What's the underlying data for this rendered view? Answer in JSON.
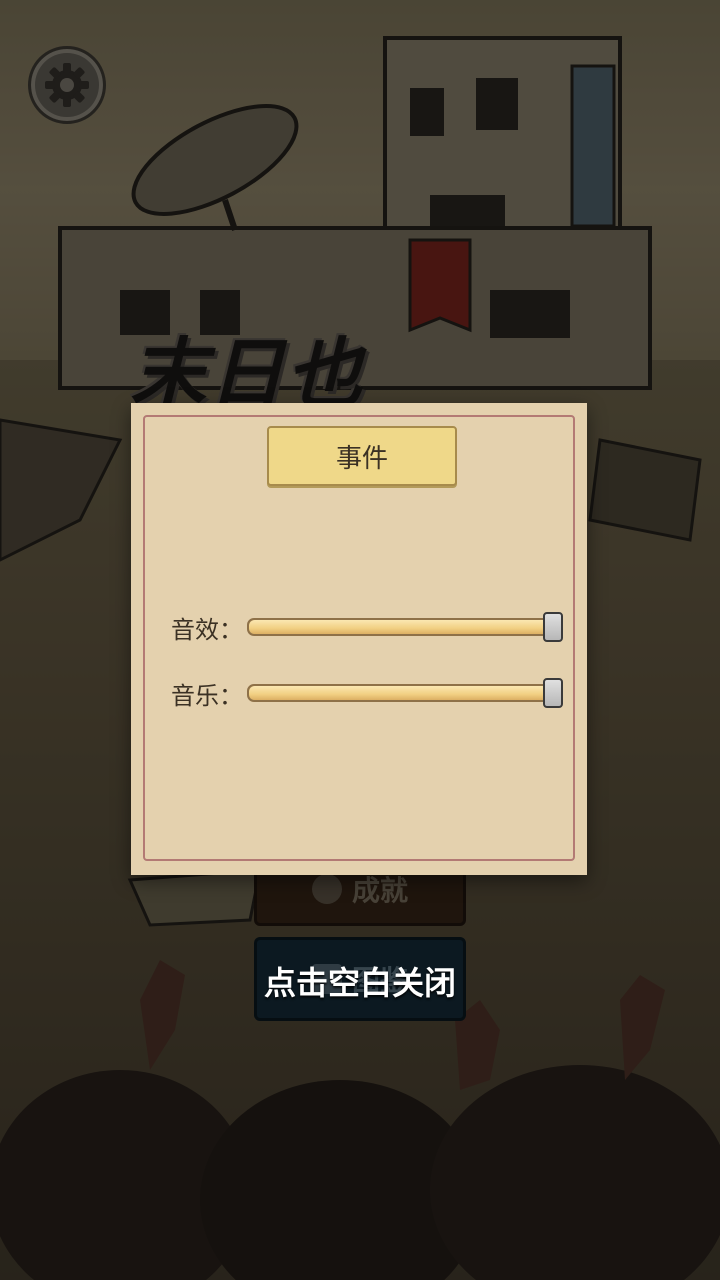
{
  "header": {
    "settings_icon": "gear-icon"
  },
  "logo": {
    "text": "末日也"
  },
  "menu": {
    "achievements_label": "成就",
    "album_label": "图鉴"
  },
  "dialog": {
    "title": "事件",
    "sound_effects": {
      "label": "音效：",
      "level": 1.0
    },
    "music": {
      "label": "音乐：",
      "level": 1.0
    }
  },
  "close_hint": "点击空白关闭",
  "colors": {
    "panel_bg": "#e4d1ae",
    "title_plate": "#efd889",
    "slider_fill": "#f1cf82"
  }
}
